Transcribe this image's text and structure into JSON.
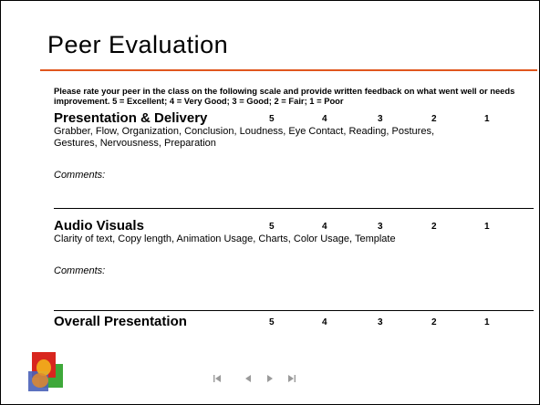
{
  "slide": {
    "title": "Peer Evaluation",
    "intro": "Please rate your peer in the class on the following scale and provide written feedback on what went well or needs improvement.  5 = Excellent; 4 = Very Good; 3 = Good; 2 = Fair; 1 = Poor",
    "sections": [
      {
        "heading": "Presentation & Delivery",
        "scale": [
          "5",
          "4",
          "3",
          "2",
          "1"
        ],
        "criteria": "Grabber, Flow, Organization, Conclusion, Loudness, Eye Contact, Reading, Postures, Gestures, Nervousness, Preparation",
        "comments_label": "Comments:"
      },
      {
        "heading": "Audio Visuals",
        "scale": [
          "5",
          "4",
          "3",
          "2",
          "1"
        ],
        "criteria": "Clarity of text, Copy length, Animation Usage, Charts, Color Usage, Template",
        "comments_label": "Comments:"
      },
      {
        "heading": "Overall Presentation",
        "scale": [
          "5",
          "4",
          "3",
          "2",
          "1"
        ]
      }
    ]
  },
  "nav": {
    "first_icon": "first-slide-icon",
    "prev_icon": "previous-slide-icon",
    "next_icon": "next-slide-icon",
    "last_icon": "last-slide-icon"
  },
  "colors": {
    "accent_rule": "#e0561e",
    "nav_icon": "#9a9a9a"
  }
}
